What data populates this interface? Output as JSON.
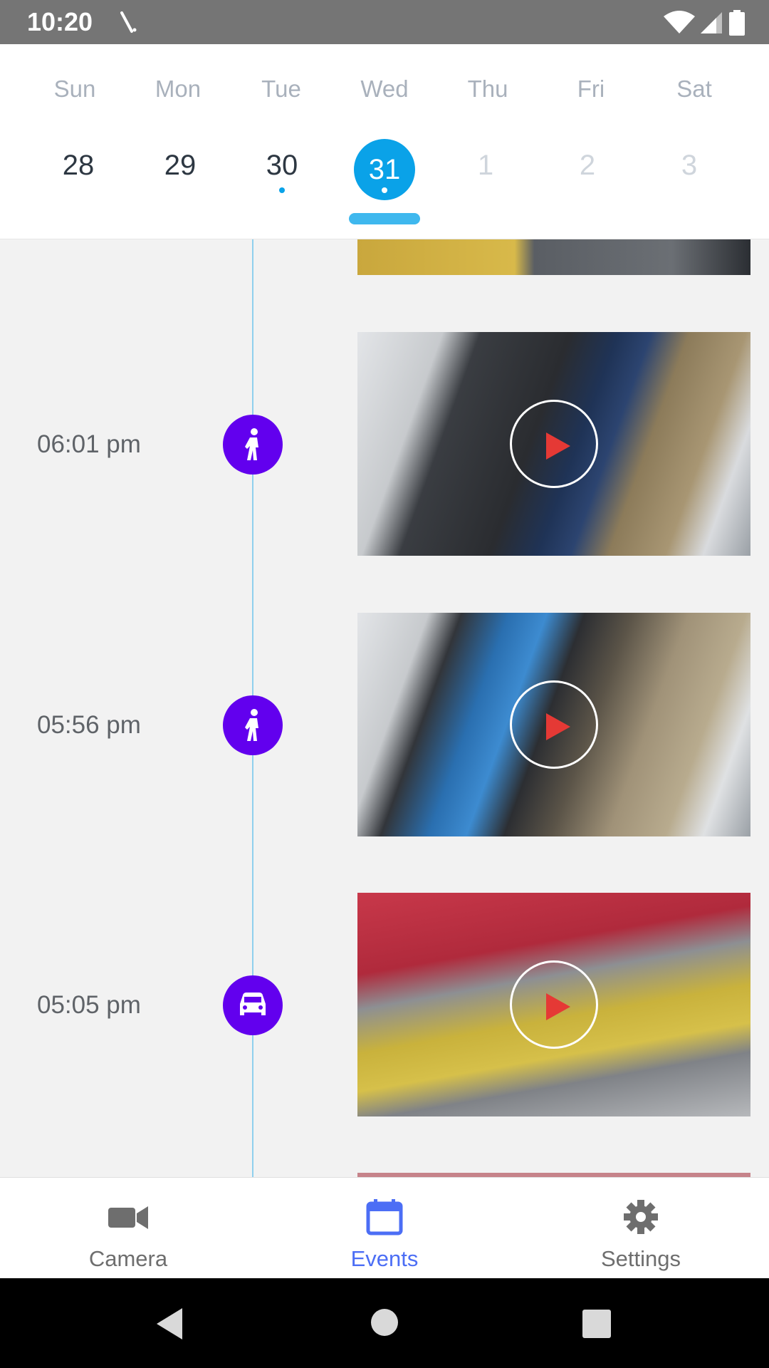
{
  "status_bar": {
    "time": "10:20",
    "icons": [
      "wifi-icon",
      "signal-icon",
      "battery-icon"
    ]
  },
  "calendar": {
    "day_names": [
      "Sun",
      "Mon",
      "Tue",
      "Wed",
      "Thu",
      "Fri",
      "Sat"
    ],
    "dates": [
      "28",
      "29",
      "30",
      "31",
      "1",
      "2",
      "3"
    ],
    "selected_date": "31",
    "accent_color": "#0aa2e8"
  },
  "events": [
    {
      "time": "06:01 pm",
      "type": "person-icon"
    },
    {
      "time": "05:56 pm",
      "type": "person-icon"
    },
    {
      "time": "05:05 pm",
      "type": "car-icon"
    }
  ],
  "bottom_nav": {
    "camera_label": "Camera",
    "events_label": "Events",
    "settings_label": "Settings",
    "active": "Events",
    "active_color": "#4c6ef5"
  },
  "badge_color": "#6200ee",
  "play_color": "#e53935"
}
